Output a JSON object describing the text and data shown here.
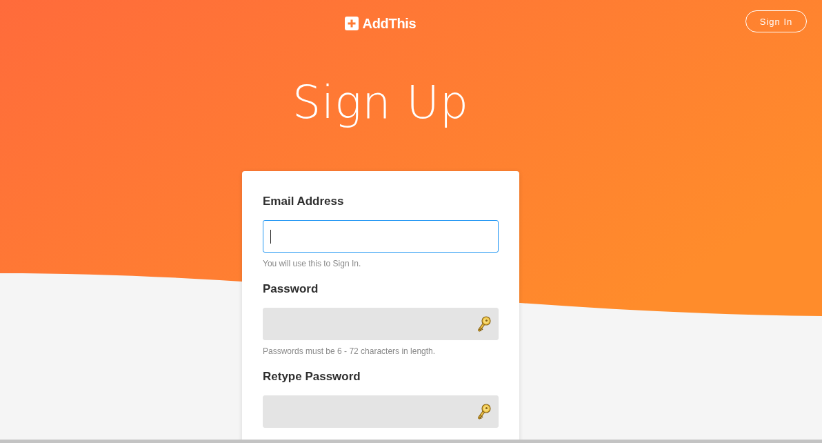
{
  "header": {
    "logo": {
      "text": "AddThis"
    },
    "sign_in_button": "Sign In"
  },
  "title": "Sign Up",
  "form": {
    "fields": [
      {
        "label": "Email Address",
        "kind": "text",
        "focused": true,
        "hint": "You will use this to Sign In."
      },
      {
        "label": "Password",
        "kind": "password",
        "focused": false,
        "hint": "Passwords must be 6 - 72 characters in length."
      },
      {
        "label": "Retype Password",
        "kind": "password",
        "focused": false
      }
    ]
  }
}
